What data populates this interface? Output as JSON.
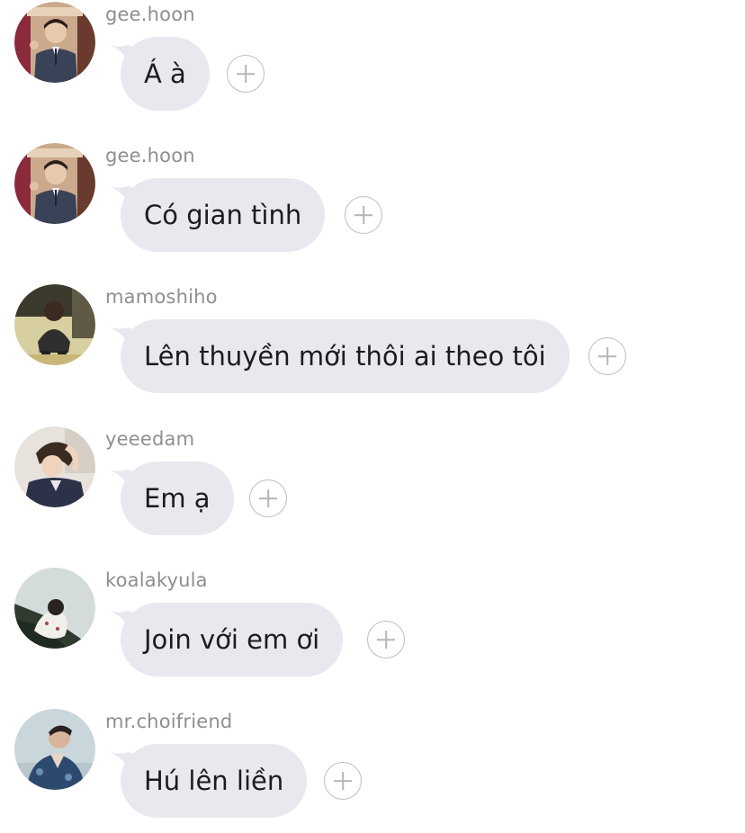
{
  "messages": [
    {
      "username": "gee.hoon",
      "text": "Á à",
      "avatar": "avatar-geehoon-photo"
    },
    {
      "username": "gee.hoon",
      "text": "Có gian tình",
      "avatar": "avatar-geehoon-photo"
    },
    {
      "username": "mamoshiho",
      "text": "Lên thuyền mới thôi ai theo tôi",
      "avatar": "avatar-mamoshiho-photo"
    },
    {
      "username": "yeeedam",
      "text": "Em ạ",
      "avatar": "avatar-yeeedam-photo"
    },
    {
      "username": "koalakyula",
      "text": "Join với em ơi",
      "avatar": "avatar-koalakyula-photo"
    },
    {
      "username": "mr.choifriend",
      "text": "Hú lên liền",
      "avatar": "avatar-mrchoifriend-photo"
    }
  ],
  "colors": {
    "bubble": "#e8e9ee",
    "username": "#8e8e93",
    "text": "#1c1c1e",
    "reaction_border": "#bfbfc4"
  }
}
